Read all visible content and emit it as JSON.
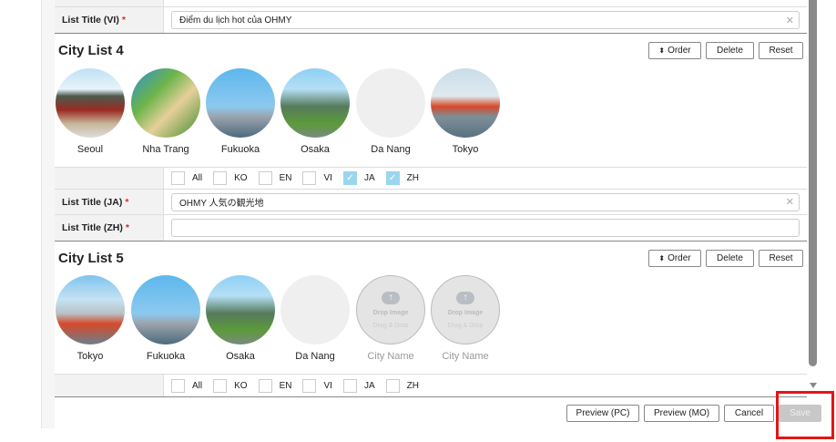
{
  "top_row": {
    "label": "List Title (VI)",
    "value": "Điểm du lịch hot của OHMY"
  },
  "lists": [
    {
      "title": "City List 4",
      "order": "Order",
      "delete": "Delete",
      "reset": "Reset",
      "cities": [
        {
          "name": "Seoul"
        },
        {
          "name": "Nha Trang"
        },
        {
          "name": "Fukuoka"
        },
        {
          "name": "Osaka"
        },
        {
          "name": "Da Nang"
        },
        {
          "name": "Tokyo"
        }
      ],
      "langs": [
        {
          "label": "All",
          "checked": false
        },
        {
          "label": "KO",
          "checked": false
        },
        {
          "label": "EN",
          "checked": false
        },
        {
          "label": "VI",
          "checked": false
        },
        {
          "label": "JA",
          "checked": true
        },
        {
          "label": "ZH",
          "checked": true
        }
      ],
      "title_ja_label": "List Title (JA)",
      "title_ja": "OHMY 人気の観光地",
      "title_zh_label": "List Title (ZH)",
      "title_zh": ""
    },
    {
      "title": "City List 5",
      "order": "Order",
      "delete": "Delete",
      "reset": "Reset",
      "cities": [
        {
          "name": "Tokyo"
        },
        {
          "name": "Fukuoka"
        },
        {
          "name": "Osaka"
        },
        {
          "name": "Da Nang"
        },
        {
          "name": "City Name"
        },
        {
          "name": "City Name"
        }
      ],
      "drop_label": "Drop Image",
      "drag_label": "Drag & Drop",
      "langs": [
        {
          "label": "All",
          "checked": false
        },
        {
          "label": "KO",
          "checked": false
        },
        {
          "label": "EN",
          "checked": false
        },
        {
          "label": "VI",
          "checked": false
        },
        {
          "label": "JA",
          "checked": false
        },
        {
          "label": "ZH",
          "checked": false
        }
      ]
    }
  ],
  "footer": {
    "preview_pc": "Preview (PC)",
    "preview_mo": "Preview (MO)",
    "cancel": "Cancel",
    "save": "Save"
  },
  "required_mark": "*"
}
